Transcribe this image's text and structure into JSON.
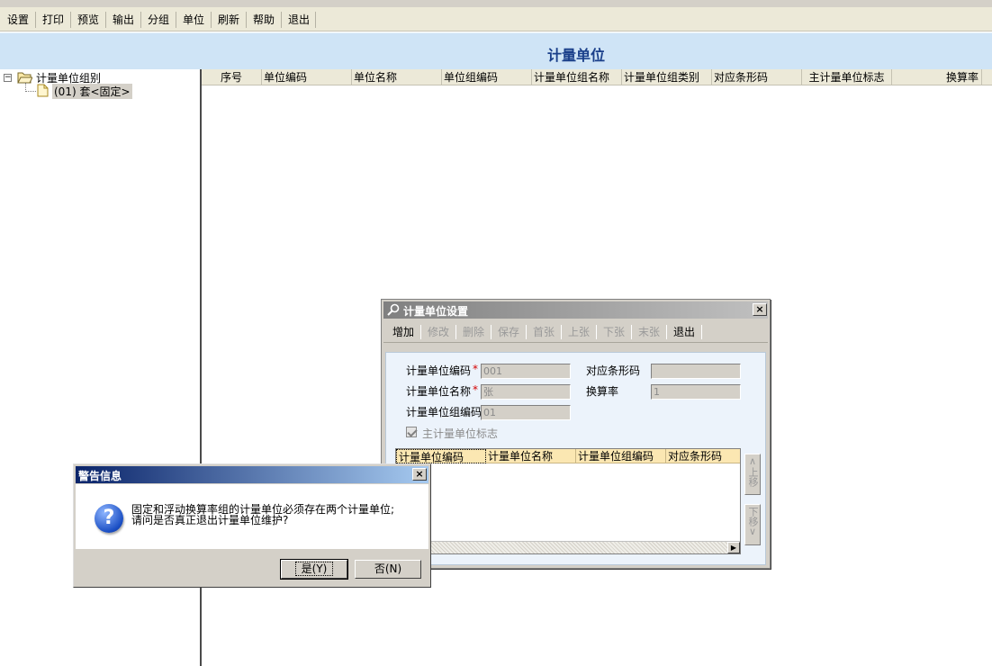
{
  "toolbar": {
    "items": [
      "设置",
      "打印",
      "预览",
      "输出",
      "分组",
      "单位",
      "刷新",
      "帮助",
      "退出"
    ]
  },
  "window_title": "计量单位",
  "tree": {
    "root_label": "计量单位组别",
    "child_label": "(01) 套<固定>"
  },
  "grid": {
    "columns": [
      "序号",
      "单位编码",
      "单位名称",
      "单位组编码",
      "计量单位组名称",
      "计量单位组类别",
      "对应条形码",
      "主计量单位标志",
      "换算率"
    ]
  },
  "unit_dialog": {
    "title": "计量单位设置",
    "tools": [
      {
        "label": "增加",
        "enabled": true
      },
      {
        "label": "修改",
        "enabled": false
      },
      {
        "label": "删除",
        "enabled": false
      },
      {
        "label": "保存",
        "enabled": false
      },
      {
        "label": "首张",
        "enabled": false
      },
      {
        "label": "上张",
        "enabled": false
      },
      {
        "label": "下张",
        "enabled": false
      },
      {
        "label": "末张",
        "enabled": false
      },
      {
        "label": "退出",
        "enabled": true
      }
    ],
    "fields": {
      "code_label": "计量单位编码",
      "code_value": "001",
      "name_label": "计量单位名称",
      "name_value": "张",
      "group_code_label": "计量单位组编码",
      "group_code_value": "01",
      "barcode_label": "对应条形码",
      "barcode_value": "",
      "rate_label": "换算率",
      "rate_value": "1",
      "required_mark": "*"
    },
    "main_unit_flag_label": "主计量单位标志",
    "main_unit_flag_checked": true,
    "inner_grid_columns": [
      "计量单位编码",
      "计量单位名称",
      "计量单位组编码",
      "对应条形码"
    ],
    "move_up_label": "上移",
    "move_down_label": "下移"
  },
  "warning_dialog": {
    "title": "警告信息",
    "message_line1": "固定和浮动换算率组的计量单位必须存在两个计量单位;",
    "message_line2": "请问是否真正退出计量单位维护?",
    "yes_label": "是(Y)",
    "no_label": "否(N)"
  }
}
